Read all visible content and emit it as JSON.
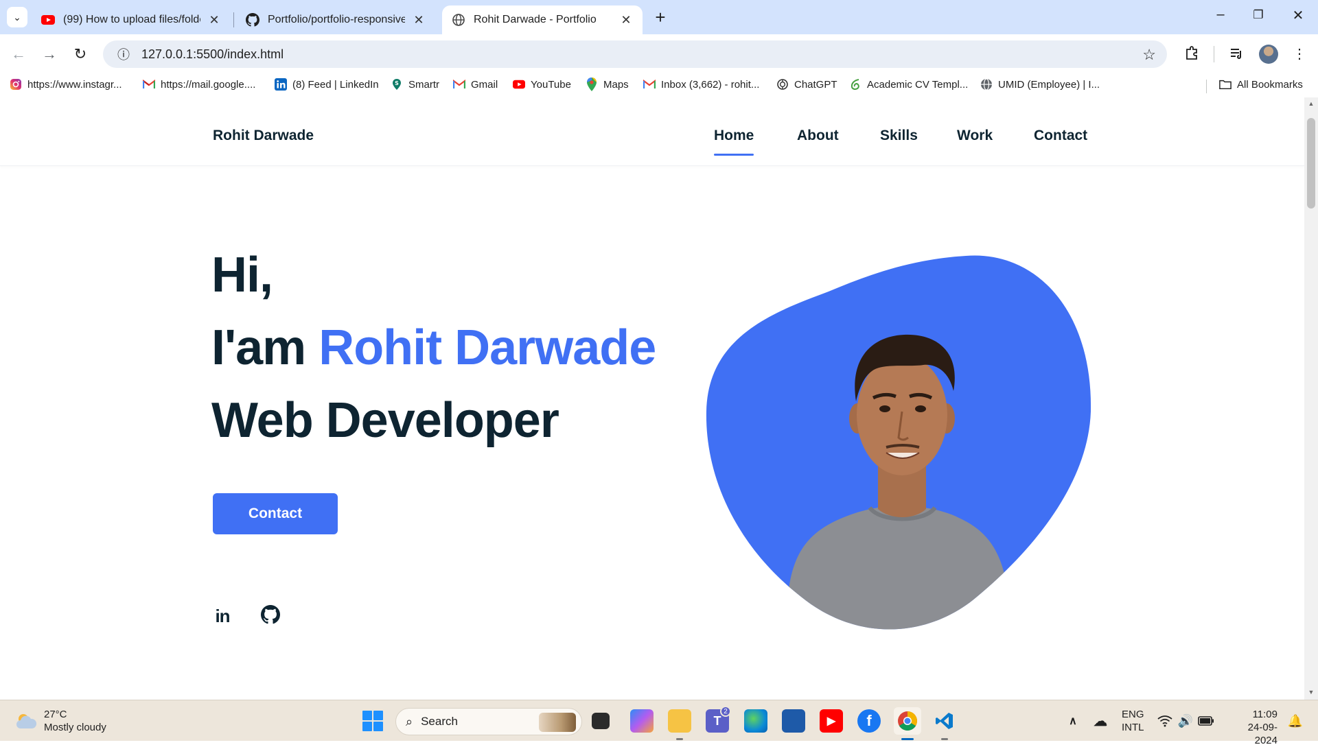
{
  "browser": {
    "tabs": [
      {
        "title": "(99) How to upload files/folders",
        "icon": "youtube-icon"
      },
      {
        "title": "Portfolio/portfolio-responsive-c",
        "icon": "github-icon"
      },
      {
        "title": "Rohit Darwade - Portfolio",
        "icon": "globe-icon",
        "active": true
      }
    ],
    "url": "127.0.0.1:5500/index.html",
    "bookmarks": [
      {
        "label": "https://www.instagr...",
        "icon": "instagram-icon"
      },
      {
        "label": "https://mail.google....",
        "icon": "gmail-icon"
      },
      {
        "label": "(8) Feed | LinkedIn",
        "icon": "linkedin-icon"
      },
      {
        "label": "Smartr",
        "icon": "smartr-icon"
      },
      {
        "label": "Gmail",
        "icon": "gmail-icon"
      },
      {
        "label": "YouTube",
        "icon": "youtube-icon"
      },
      {
        "label": "Maps",
        "icon": "maps-icon"
      },
      {
        "label": "Inbox (3,662) - rohit...",
        "icon": "gmail-icon"
      },
      {
        "label": "ChatGPT",
        "icon": "chatgpt-icon"
      },
      {
        "label": "Academic CV Templ...",
        "icon": "overleaf-icon"
      },
      {
        "label": "UMID (Employee) | I...",
        "icon": "globe-icon"
      }
    ],
    "all_bookmarks": "All Bookmarks"
  },
  "site": {
    "logo": "Rohit Darwade",
    "nav": [
      "Home",
      "About",
      "Skills",
      "Work",
      "Contact"
    ],
    "active_nav": "Home",
    "hero": {
      "greeting": "Hi,",
      "intro_prefix": "I'am ",
      "name": "Rohit Darwade",
      "role": "Web Developer"
    },
    "cta": "Contact",
    "socials": [
      "linkedin-icon",
      "github-icon"
    ],
    "accent": "#4070f4",
    "text_color": "#0e2431"
  },
  "taskbar": {
    "temperature": "27°C",
    "weather": "Mostly cloudy",
    "search_placeholder": "Search",
    "teams_badge": "2",
    "lang_top": "ENG",
    "lang_bottom": "INTL",
    "time": "11:09",
    "date": "24-09-2024"
  }
}
